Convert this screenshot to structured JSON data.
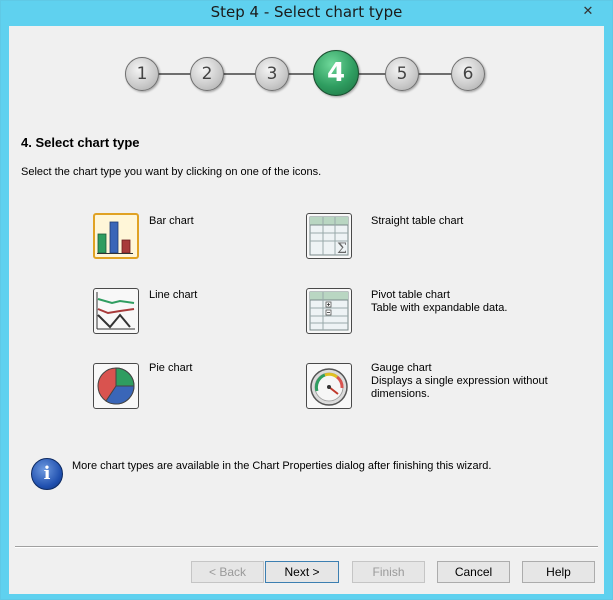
{
  "window": {
    "title": "Step 4 - Select chart type",
    "close_glyph": "✕"
  },
  "steps": [
    {
      "label": "1",
      "active": false
    },
    {
      "label": "2",
      "active": false
    },
    {
      "label": "3",
      "active": false
    },
    {
      "label": "4",
      "active": true
    },
    {
      "label": "5",
      "active": false
    },
    {
      "label": "6",
      "active": false
    }
  ],
  "heading": "4. Select chart type",
  "instructions": "Select the chart type you want by clicking on one of the icons.",
  "chart_types": [
    {
      "name": "Bar chart",
      "description": "",
      "icon": "bar-chart-icon",
      "selected": true
    },
    {
      "name": "Straight table chart",
      "description": "",
      "icon": "straight-table-icon",
      "selected": false
    },
    {
      "name": "Line chart",
      "description": "",
      "icon": "line-chart-icon",
      "selected": false
    },
    {
      "name": "Pivot table chart",
      "description": "Table with expandable data.",
      "icon": "pivot-table-icon",
      "selected": false
    },
    {
      "name": "Pie chart",
      "description": "",
      "icon": "pie-chart-icon",
      "selected": false
    },
    {
      "name": "Gauge chart",
      "description": "Displays a single expression without dimensions.",
      "icon": "gauge-chart-icon",
      "selected": false
    }
  ],
  "info": {
    "glyph": "i",
    "text": "More chart types are available in the Chart Properties dialog after finishing this wizard."
  },
  "buttons": {
    "back": "< Back",
    "next": "Next >",
    "finish": "Finish",
    "cancel": "Cancel",
    "help": "Help"
  },
  "colors": {
    "title_bar": "#5fd1ef",
    "active_step": "#2f9d60",
    "selected_icon_border": "#e0a224"
  }
}
